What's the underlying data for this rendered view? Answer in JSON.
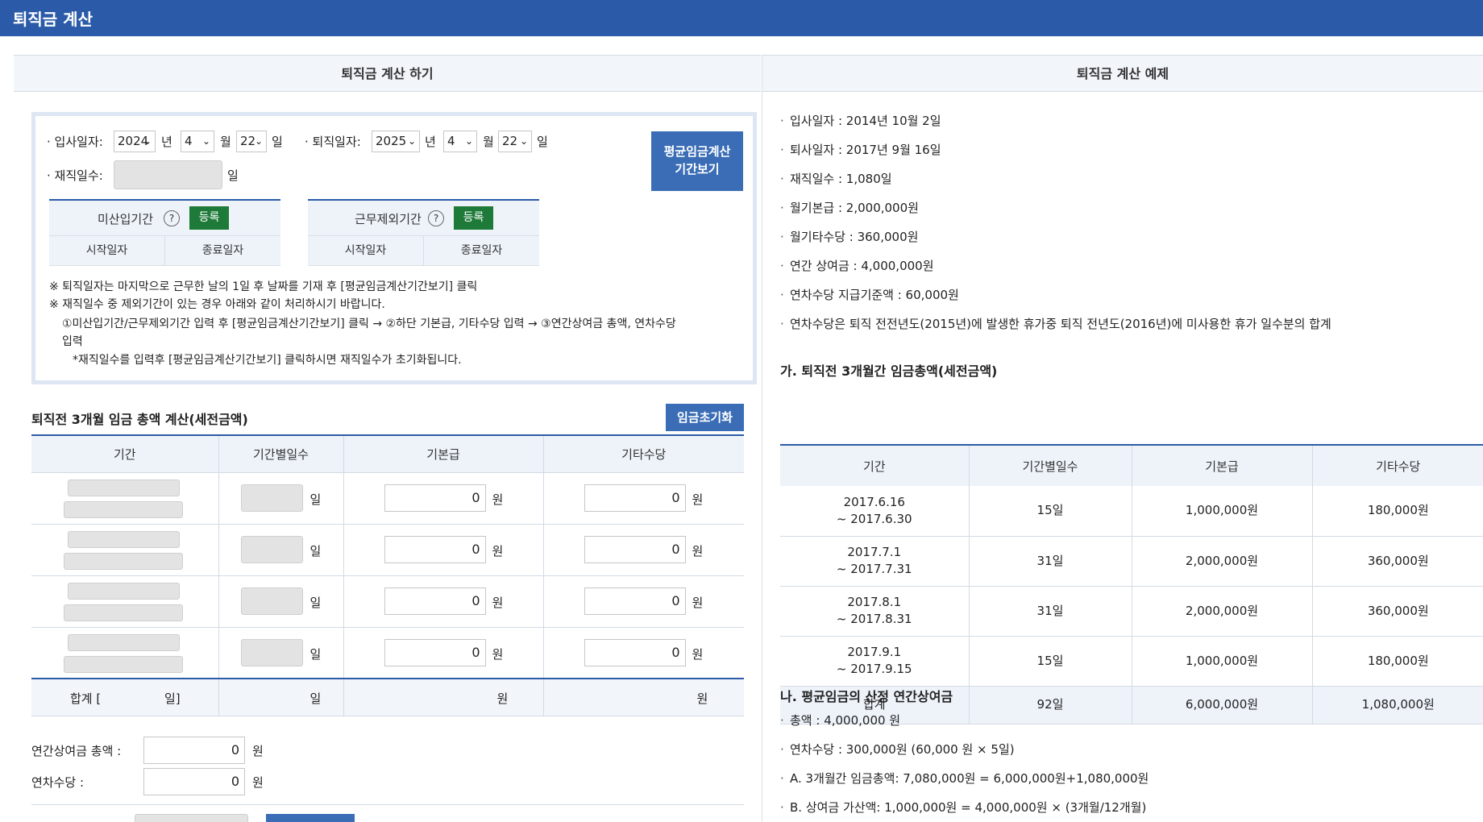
{
  "app": {
    "title": "퇴직금 계산"
  },
  "left": {
    "header": "퇴직금 계산 하기",
    "hire": {
      "label": "입사일자:",
      "year": "2024",
      "month": "4",
      "day": "22",
      "unit_year": "년",
      "unit_month": "월",
      "unit_day": "일"
    },
    "retire": {
      "label": "퇴직일자:",
      "year": "2025",
      "month": "4",
      "day": "22",
      "unit_year": "년",
      "unit_month": "월",
      "unit_day": "일"
    },
    "work_days": {
      "label": "재직일수:",
      "value": "",
      "unit": "일"
    },
    "avg_button": [
      "평균임금계산",
      "기간보기"
    ],
    "unpaid_period": {
      "label": "미산입기간",
      "help": "?",
      "register": "등록",
      "start": "시작일자",
      "end": "종료일자"
    },
    "excluded_period": {
      "label": "근무제외기간",
      "help": "?",
      "register": "등록",
      "start": "시작일자",
      "end": "종료일자"
    },
    "notes": [
      "※ 퇴직일자는 마지막으로 근무한 날의 1일 후 날짜를 기재 후 [평균임금계산기간보기] 클릭",
      "※ 재직일수 중 제외기간이 있는 경우 아래와 같이 처리하시기 바랍니다.",
      "①미산입기간/근무제외기간 입력 후 [평균임금계산기간보기] 클릭 → ②하단 기본급, 기타수당 입력 → ③연간상여금 총액, 연차수당",
      "입력",
      "*재직일수를 입력후 [평균임금계산기간보기] 클릭하시면 재직일수가 초기화됩니다."
    ],
    "wage_section": {
      "title": "퇴직전 3개월 임금 총액 계산(세전금액)",
      "reset_button": "임금초기화",
      "columns": [
        "기간",
        "기간별일수",
        "기본급",
        "기타수당"
      ],
      "rows": [
        {
          "days_unit": "일",
          "base": "0",
          "base_unit": "원",
          "other": "0",
          "other_unit": "원"
        },
        {
          "days_unit": "일",
          "base": "0",
          "base_unit": "원",
          "other": "0",
          "other_unit": "원"
        },
        {
          "days_unit": "일",
          "base": "0",
          "base_unit": "원",
          "other": "0",
          "other_unit": "원"
        },
        {
          "days_unit": "일",
          "base": "0",
          "base_unit": "원",
          "other": "0",
          "other_unit": "원"
        }
      ],
      "sum": {
        "label_open": "합계 [",
        "label_close": "일]",
        "days_unit": "일",
        "base_unit": "원",
        "other_unit": "원"
      }
    },
    "bonus": {
      "label": "연간상여금 총액 :",
      "value": "0",
      "unit": "원"
    },
    "annual_leave": {
      "label": "연차수당 :",
      "value": "0",
      "unit": "원"
    }
  },
  "right": {
    "header": "퇴직금 계산 예제",
    "items": [
      "입사일자 : 2014년 10월 2일",
      "퇴사일자 : 2017년 9월 16일",
      "재직일수 : 1,080일",
      "월기본급 : 2,000,000원",
      "월기타수당 : 360,000원",
      "연간 상여금 : 4,000,000원",
      "연차수당 지급기준액 : 60,000원",
      "연차수당은 퇴직 전전년도(2015년)에 발생한 휴가중 퇴직 전년도(2016년)에 미사용한 휴가 일수분의 합계"
    ],
    "section_a": {
      "title": "가. 퇴직전 3개월간 임금총액(세전금액)",
      "columns": [
        "기간",
        "기간별일수",
        "기본급",
        "기타수당"
      ],
      "rows": [
        {
          "from": "2017.6.16",
          "to": "~ 2017.6.30",
          "days": "15일",
          "base": "1,000,000원",
          "other": "180,000원"
        },
        {
          "from": "2017.7.1",
          "to": "~ 2017.7.31",
          "days": "31일",
          "base": "2,000,000원",
          "other": "360,000원"
        },
        {
          "from": "2017.8.1",
          "to": "~ 2017.8.31",
          "days": "31일",
          "base": "2,000,000원",
          "other": "360,000원"
        },
        {
          "from": "2017.9.1",
          "to": "~ 2017.9.15",
          "days": "15일",
          "base": "1,000,000원",
          "other": "180,000원"
        }
      ],
      "sum": {
        "label": "합계",
        "days": "92일",
        "base": "6,000,000원",
        "other": "1,080,000원"
      }
    },
    "section_b": {
      "title": "나. 평균임금의 산정 연간상여금",
      "items": [
        "총액 : 4,000,000 원",
        "연차수당 : 300,000원 (60,000 원 × 5일)",
        "A. 3개월간 임금총액: 7,080,000원 = 6,000,000원+1,080,000원",
        "B. 상여금 가산액: 1,000,000원 = 4,000,000원 × (3개월/12개월)"
      ]
    }
  }
}
